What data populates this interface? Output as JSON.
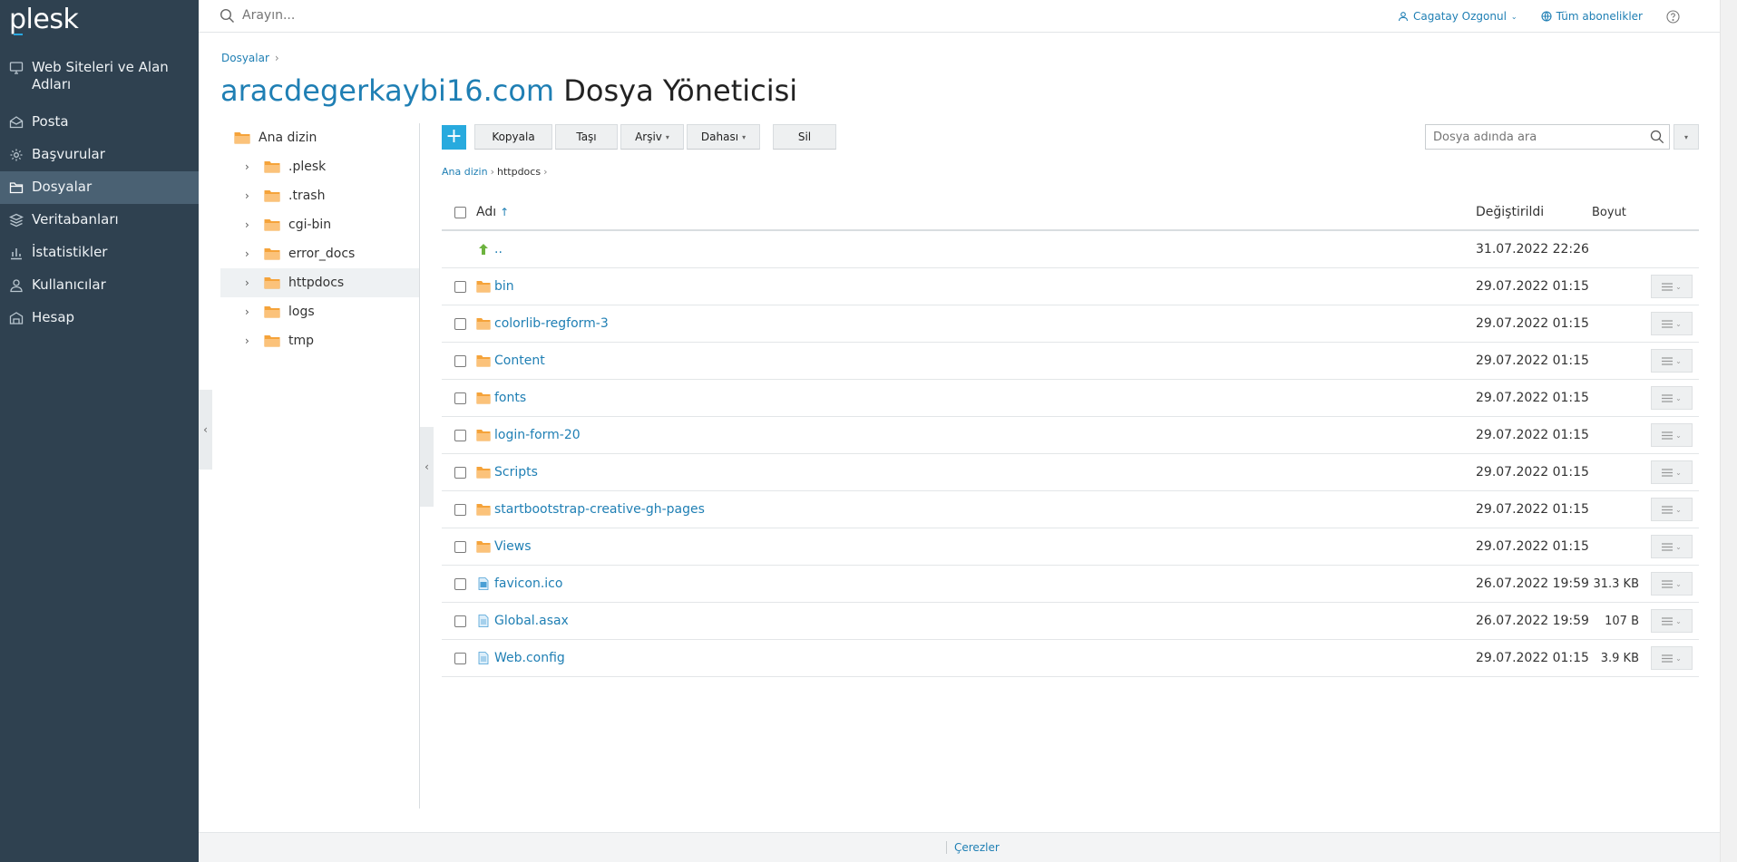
{
  "sidebar": {
    "logo": "plesk",
    "items": [
      {
        "label": "Web Siteleri ve Alan Adları",
        "icon": "monitor-icon"
      },
      {
        "label": "Posta",
        "icon": "mail-icon"
      },
      {
        "label": "Başvurular",
        "icon": "gear-icon"
      },
      {
        "label": "Dosyalar",
        "icon": "folder-icon",
        "active": true
      },
      {
        "label": "Veritabanları",
        "icon": "database-icon"
      },
      {
        "label": "İstatistikler",
        "icon": "chart-icon"
      },
      {
        "label": "Kullanıcılar",
        "icon": "user-icon"
      },
      {
        "label": "Hesap",
        "icon": "account-icon"
      }
    ]
  },
  "topbar": {
    "search_placeholder": "Arayın...",
    "user_name": "Cagatay Ozgonul",
    "subscriptions": "Tüm abonelikler"
  },
  "breadcrumb": {
    "root": "Dosyalar"
  },
  "title": {
    "domain": "aracdegerkaybi16.com",
    "suffix": "Dosya Yöneticisi"
  },
  "tree": {
    "root": "Ana dizin",
    "children": [
      ".plesk",
      ".trash",
      "cgi-bin",
      "error_docs",
      "httpdocs",
      "logs",
      "tmp"
    ],
    "selected": "httpdocs"
  },
  "toolbar": {
    "copy": "Kopyala",
    "move": "Taşı",
    "archive": "Arşiv",
    "more": "Dahası",
    "delete": "Sil",
    "file_search_placeholder": "Dosya adında ara"
  },
  "path": {
    "root": "Ana dizin",
    "current": "httpdocs"
  },
  "table": {
    "headers": {
      "name": "Adı",
      "modified": "Değiştirildi",
      "size": "Boyut"
    },
    "up_row": {
      "name": "..",
      "modified": "31.07.2022 22:26"
    },
    "rows": [
      {
        "name": "bin",
        "type": "folder",
        "modified": "29.07.2022 01:15",
        "size": ""
      },
      {
        "name": "colorlib-regform-3",
        "type": "folder",
        "modified": "29.07.2022 01:15",
        "size": ""
      },
      {
        "name": "Content",
        "type": "folder",
        "modified": "29.07.2022 01:15",
        "size": ""
      },
      {
        "name": "fonts",
        "type": "folder",
        "modified": "29.07.2022 01:15",
        "size": ""
      },
      {
        "name": "login-form-20",
        "type": "folder",
        "modified": "29.07.2022 01:15",
        "size": ""
      },
      {
        "name": "Scripts",
        "type": "folder",
        "modified": "29.07.2022 01:15",
        "size": ""
      },
      {
        "name": "startbootstrap-creative-gh-pages",
        "type": "folder",
        "modified": "29.07.2022 01:15",
        "size": ""
      },
      {
        "name": "Views",
        "type": "folder",
        "modified": "29.07.2022 01:15",
        "size": ""
      },
      {
        "name": "favicon.ico",
        "type": "image",
        "modified": "26.07.2022 19:59",
        "size": "31.3 KB"
      },
      {
        "name": "Global.asax",
        "type": "file",
        "modified": "26.07.2022 19:59",
        "size": "107 B"
      },
      {
        "name": "Web.config",
        "type": "file",
        "modified": "29.07.2022 01:15",
        "size": "3.9 KB"
      }
    ]
  },
  "footer": {
    "cookies": "Çerezler"
  },
  "colors": {
    "accent": "#1f7fb4",
    "sidebar_bg": "#2f4150",
    "folder": "#f5a33a",
    "primary_button": "#28aade"
  }
}
